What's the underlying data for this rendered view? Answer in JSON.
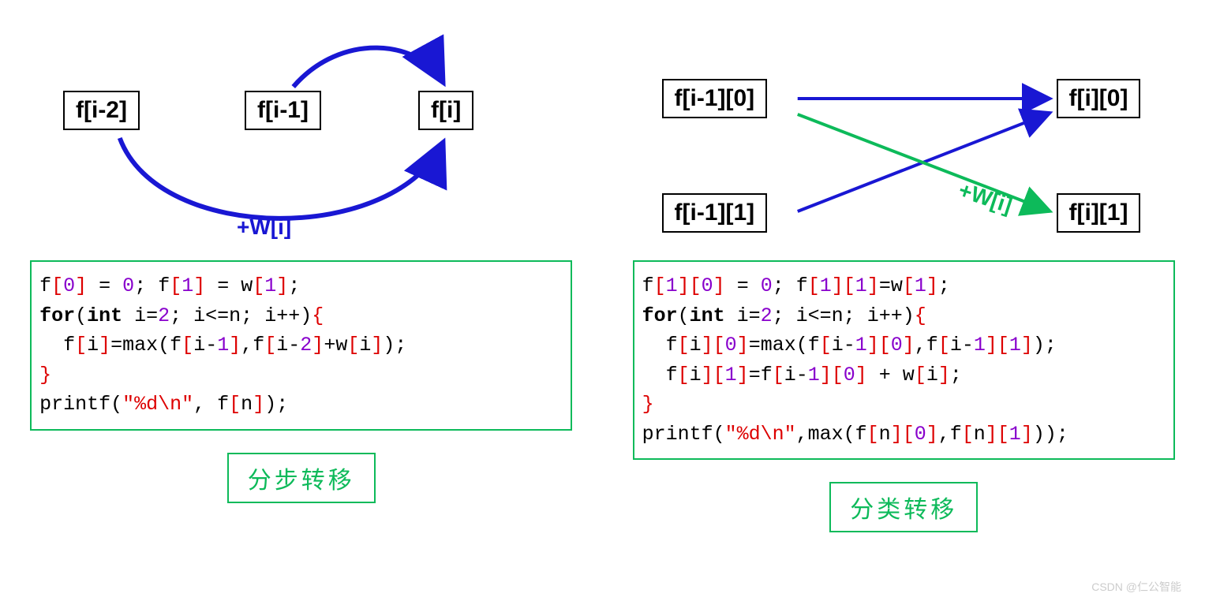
{
  "left": {
    "nodes": {
      "a": "f[i-2]",
      "b": "f[i-1]",
      "c": "f[i]"
    },
    "edge_label": "+W[i]",
    "label": "分步转移",
    "code": {
      "line1": {
        "p1": "f",
        "b1": "[",
        "n1": "0",
        "b2": "]",
        "p2": " = ",
        "n2": "0",
        "p3": "; f",
        "b3": "[",
        "n3": "1",
        "b4": "]",
        "p4": " = w",
        "b5": "[",
        "n4": "1",
        "b6": "]",
        "p5": ";"
      },
      "line2": {
        "k1": "for",
        "p1": "(",
        "k2": "int",
        "p2": " i=",
        "n1": "2",
        "p3": "; i<=n; i++)",
        "b1": "{"
      },
      "line3": {
        "p1": "  f",
        "b1": "[",
        "p2": "i",
        "b2": "]",
        "p3": "=max(f",
        "b3": "[",
        "p4": "i-",
        "n1": "1",
        "b4": "]",
        "p5": ",f",
        "b5": "[",
        "p6": "i-",
        "n2": "2",
        "b6": "]",
        "p7": "+w",
        "b7": "[",
        "p8": "i",
        "b8": "]",
        "p9": ");"
      },
      "line4": {
        "b1": "}"
      },
      "line5": {
        "p1": "printf(",
        "s1": "\"%d\\n\"",
        "p2": ", f",
        "b1": "[",
        "p3": "n",
        "b2": "]",
        "p4": ");"
      }
    }
  },
  "right": {
    "nodes": {
      "a": "f[i-1][0]",
      "b": "f[i-1][1]",
      "c": "f[i][0]",
      "d": "f[i][1]"
    },
    "edge_label": "+W[i]",
    "label": "分类转移",
    "code": {
      "line1": {
        "p1": "f",
        "b1": "[",
        "n1": "1",
        "b2": "][",
        "n2": "0",
        "b3": "]",
        "p2": " = ",
        "n3": "0",
        "p3": "; f",
        "b4": "[",
        "n4": "1",
        "b5": "][",
        "n5": "1",
        "b6": "]",
        "p4": "=w",
        "b7": "[",
        "n6": "1",
        "b8": "]",
        "p5": ";"
      },
      "line2": {
        "k1": "for",
        "p1": "(",
        "k2": "int",
        "p2": " i=",
        "n1": "2",
        "p3": "; i<=n; i++)",
        "b1": "{"
      },
      "line3": {
        "p1": "  f",
        "b1": "[",
        "p2": "i",
        "b2": "][",
        "n1": "0",
        "b3": "]",
        "p3": "=max(f",
        "b4": "[",
        "p4": "i-",
        "n2": "1",
        "b5": "][",
        "n3": "0",
        "b6": "]",
        "p5": ",f",
        "b7": "[",
        "p6": "i-",
        "n4": "1",
        "b8": "][",
        "n5": "1",
        "b9": "]",
        "p7": ");"
      },
      "line4": {
        "p1": "  f",
        "b1": "[",
        "p2": "i",
        "b2": "][",
        "n1": "1",
        "b3": "]",
        "p3": "=f",
        "b4": "[",
        "p4": "i-",
        "n2": "1",
        "b5": "][",
        "n3": "0",
        "b6": "]",
        "p5": " + w",
        "b7": "[",
        "p6": "i",
        "b8": "]",
        "p7": ";"
      },
      "line5": {
        "b1": "}"
      },
      "line6": {
        "p1": "printf(",
        "s1": "\"%d\\n\"",
        "p2": ",max(f",
        "b1": "[",
        "p3": "n",
        "b2": "][",
        "n1": "0",
        "b3": "]",
        "p4": ",f",
        "b4": "[",
        "p5": "n",
        "b5": "][",
        "n2": "1",
        "b6": "]",
        "p6": "));"
      }
    }
  },
  "watermark": "CSDN @仁公智能"
}
